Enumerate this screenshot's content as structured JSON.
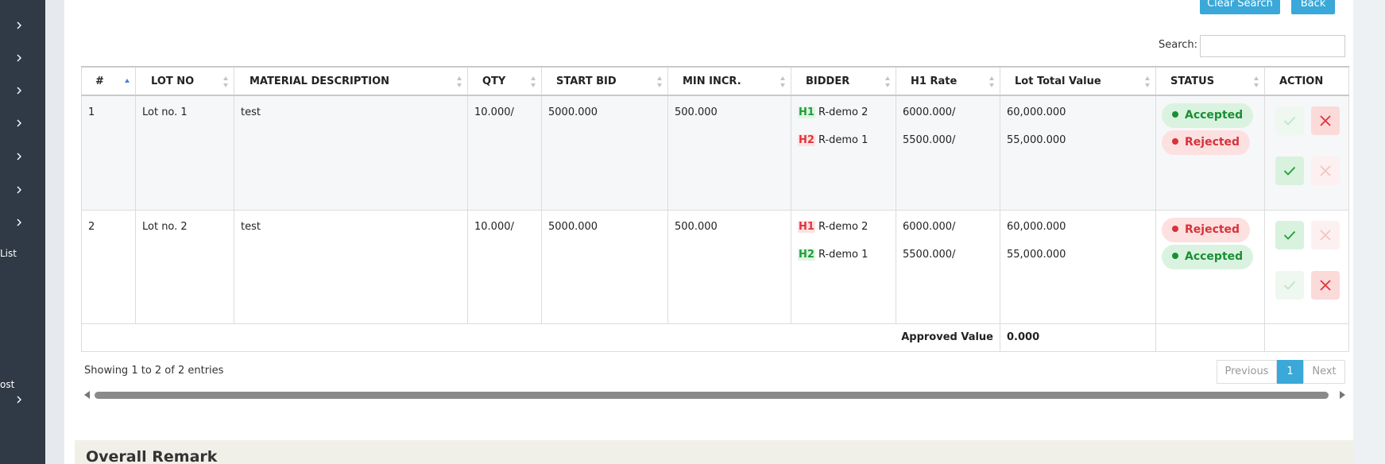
{
  "sidebar": {
    "list_label": "List",
    "post_label": "ost"
  },
  "toolbar": {
    "clear_search_label": "Clear Search",
    "back_label": "Back"
  },
  "search": {
    "label": "Search:",
    "value": ""
  },
  "table": {
    "columns": [
      "#",
      "LOT NO",
      "MATERIAL DESCRIPTION",
      "QTY",
      "START BID",
      "MIN INCR.",
      "BIDDER",
      "H1 Rate",
      "Lot Total Value",
      "STATUS",
      "ACTION"
    ],
    "rows": [
      {
        "num": "1",
        "lot_no": "Lot no. 1",
        "description": "test",
        "qty": "10.000/",
        "start_bid": "5000.000",
        "min_incr": "500.000",
        "bidders": [
          {
            "rank": "H1",
            "rank_color": "green",
            "name": "R-demo 2",
            "rate": "6000.000/",
            "total": "60,000.000"
          },
          {
            "rank": "H2",
            "rank_color": "red",
            "name": "R-demo 1",
            "rate": "5500.000/",
            "total": "55,000.000"
          }
        ],
        "statuses": [
          {
            "label": "Accepted",
            "type": "accepted"
          },
          {
            "label": "Rejected",
            "type": "rejected"
          }
        ]
      },
      {
        "num": "2",
        "lot_no": "Lot no. 2",
        "description": "test",
        "qty": "10.000/",
        "start_bid": "5000.000",
        "min_incr": "500.000",
        "bidders": [
          {
            "rank": "H1",
            "rank_color": "red",
            "name": "R-demo 2",
            "rate": "6000.000/",
            "total": "60,000.000"
          },
          {
            "rank": "H2",
            "rank_color": "green",
            "name": "R-demo 1",
            "rate": "5500.000/",
            "total": "55,000.000"
          }
        ],
        "statuses": [
          {
            "label": "Rejected",
            "type": "rejected"
          },
          {
            "label": "Accepted",
            "type": "accepted"
          }
        ]
      }
    ],
    "footer": {
      "approved_label": "Approved Value",
      "approved_value": "0.000"
    }
  },
  "info": {
    "showing": "Showing 1 to 2 of 2 entries"
  },
  "pagination": {
    "previous": "Previous",
    "page": "1",
    "next": "Next"
  },
  "remark": {
    "title": "Overall Remark"
  },
  "colors": {
    "accent": "#3aa8d8",
    "sidebar": "#2f3a46",
    "accepted": "#1a8f35",
    "rejected": "#d6333b"
  }
}
